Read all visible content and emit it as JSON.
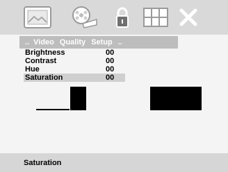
{
  "toolbar": {
    "icons": [
      "picture-icon",
      "film-reel-icon",
      "padlock-icon",
      "grid-icon",
      "close-icon"
    ]
  },
  "menu": {
    "prefix": "..",
    "tabs": [
      "Video",
      "Quality",
      "Setup"
    ],
    "suffix": ".."
  },
  "settings": [
    {
      "label": "Brightness",
      "value": "00"
    },
    {
      "label": "Contrast",
      "value": "00"
    },
    {
      "label": "Hue",
      "value": "00"
    },
    {
      "label": "Saturation",
      "value": "00"
    }
  ],
  "status": {
    "text": "Saturation"
  },
  "colors": {
    "topbar": "#d9d9d9",
    "menubar": "#bdbdbd",
    "selected": "#cfcfcf"
  }
}
